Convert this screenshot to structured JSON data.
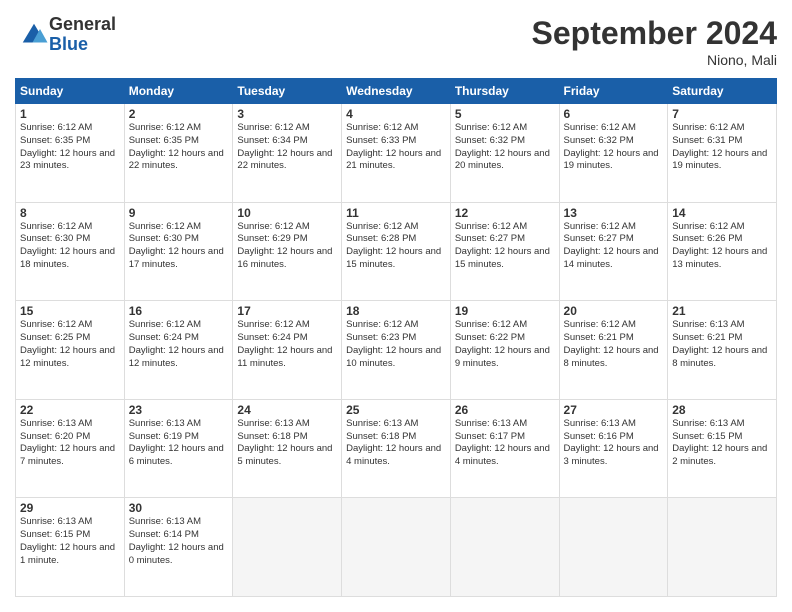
{
  "logo": {
    "general": "General",
    "blue": "Blue"
  },
  "title": "September 2024",
  "location": "Niono, Mali",
  "days_of_week": [
    "Sunday",
    "Monday",
    "Tuesday",
    "Wednesday",
    "Thursday",
    "Friday",
    "Saturday"
  ],
  "weeks": [
    [
      {
        "day": 1,
        "sunrise": "6:12 AM",
        "sunset": "6:35 PM",
        "daylight": "12 hours and 23 minutes."
      },
      {
        "day": 2,
        "sunrise": "6:12 AM",
        "sunset": "6:35 PM",
        "daylight": "12 hours and 22 minutes."
      },
      {
        "day": 3,
        "sunrise": "6:12 AM",
        "sunset": "6:34 PM",
        "daylight": "12 hours and 22 minutes."
      },
      {
        "day": 4,
        "sunrise": "6:12 AM",
        "sunset": "6:33 PM",
        "daylight": "12 hours and 21 minutes."
      },
      {
        "day": 5,
        "sunrise": "6:12 AM",
        "sunset": "6:32 PM",
        "daylight": "12 hours and 20 minutes."
      },
      {
        "day": 6,
        "sunrise": "6:12 AM",
        "sunset": "6:32 PM",
        "daylight": "12 hours and 19 minutes."
      },
      {
        "day": 7,
        "sunrise": "6:12 AM",
        "sunset": "6:31 PM",
        "daylight": "12 hours and 19 minutes."
      }
    ],
    [
      {
        "day": 8,
        "sunrise": "6:12 AM",
        "sunset": "6:30 PM",
        "daylight": "12 hours and 18 minutes."
      },
      {
        "day": 9,
        "sunrise": "6:12 AM",
        "sunset": "6:30 PM",
        "daylight": "12 hours and 17 minutes."
      },
      {
        "day": 10,
        "sunrise": "6:12 AM",
        "sunset": "6:29 PM",
        "daylight": "12 hours and 16 minutes."
      },
      {
        "day": 11,
        "sunrise": "6:12 AM",
        "sunset": "6:28 PM",
        "daylight": "12 hours and 15 minutes."
      },
      {
        "day": 12,
        "sunrise": "6:12 AM",
        "sunset": "6:27 PM",
        "daylight": "12 hours and 15 minutes."
      },
      {
        "day": 13,
        "sunrise": "6:12 AM",
        "sunset": "6:27 PM",
        "daylight": "12 hours and 14 minutes."
      },
      {
        "day": 14,
        "sunrise": "6:12 AM",
        "sunset": "6:26 PM",
        "daylight": "12 hours and 13 minutes."
      }
    ],
    [
      {
        "day": 15,
        "sunrise": "6:12 AM",
        "sunset": "6:25 PM",
        "daylight": "12 hours and 12 minutes."
      },
      {
        "day": 16,
        "sunrise": "6:12 AM",
        "sunset": "6:24 PM",
        "daylight": "12 hours and 12 minutes."
      },
      {
        "day": 17,
        "sunrise": "6:12 AM",
        "sunset": "6:24 PM",
        "daylight": "12 hours and 11 minutes."
      },
      {
        "day": 18,
        "sunrise": "6:12 AM",
        "sunset": "6:23 PM",
        "daylight": "12 hours and 10 minutes."
      },
      {
        "day": 19,
        "sunrise": "6:12 AM",
        "sunset": "6:22 PM",
        "daylight": "12 hours and 9 minutes."
      },
      {
        "day": 20,
        "sunrise": "6:12 AM",
        "sunset": "6:21 PM",
        "daylight": "12 hours and 8 minutes."
      },
      {
        "day": 21,
        "sunrise": "6:13 AM",
        "sunset": "6:21 PM",
        "daylight": "12 hours and 8 minutes."
      }
    ],
    [
      {
        "day": 22,
        "sunrise": "6:13 AM",
        "sunset": "6:20 PM",
        "daylight": "12 hours and 7 minutes."
      },
      {
        "day": 23,
        "sunrise": "6:13 AM",
        "sunset": "6:19 PM",
        "daylight": "12 hours and 6 minutes."
      },
      {
        "day": 24,
        "sunrise": "6:13 AM",
        "sunset": "6:18 PM",
        "daylight": "12 hours and 5 minutes."
      },
      {
        "day": 25,
        "sunrise": "6:13 AM",
        "sunset": "6:18 PM",
        "daylight": "12 hours and 4 minutes."
      },
      {
        "day": 26,
        "sunrise": "6:13 AM",
        "sunset": "6:17 PM",
        "daylight": "12 hours and 4 minutes."
      },
      {
        "day": 27,
        "sunrise": "6:13 AM",
        "sunset": "6:16 PM",
        "daylight": "12 hours and 3 minutes."
      },
      {
        "day": 28,
        "sunrise": "6:13 AM",
        "sunset": "6:15 PM",
        "daylight": "12 hours and 2 minutes."
      }
    ],
    [
      {
        "day": 29,
        "sunrise": "6:13 AM",
        "sunset": "6:15 PM",
        "daylight": "12 hours and 1 minute."
      },
      {
        "day": 30,
        "sunrise": "6:13 AM",
        "sunset": "6:14 PM",
        "daylight": "12 hours and 0 minutes."
      },
      null,
      null,
      null,
      null,
      null
    ]
  ]
}
